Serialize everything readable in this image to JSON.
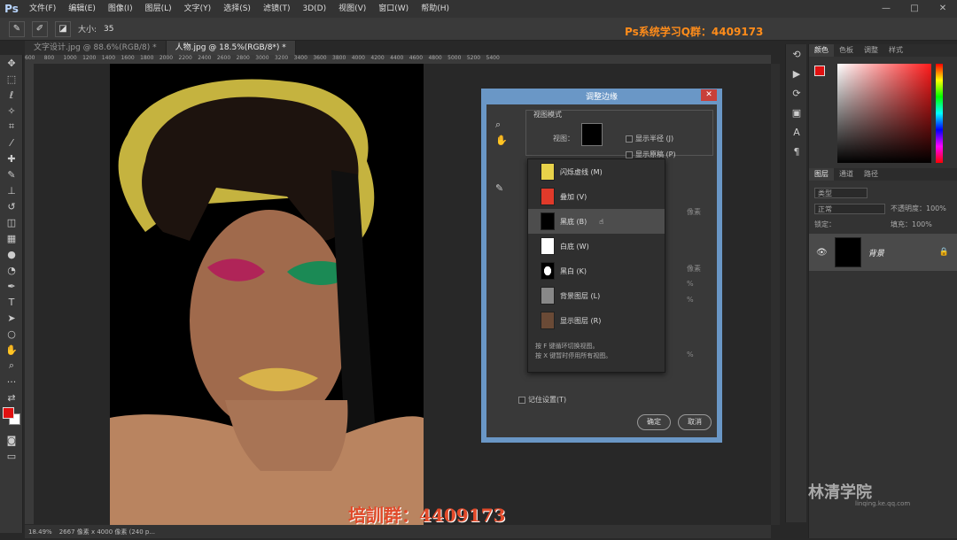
{
  "app": {
    "logo": "Ps"
  },
  "menu": [
    "文件(F)",
    "编辑(E)",
    "图像(I)",
    "图层(L)",
    "文字(Y)",
    "选择(S)",
    "滤镜(T)",
    "3D(D)",
    "视图(V)",
    "窗口(W)",
    "帮助(H)"
  ],
  "options": {
    "size_label": "大小:",
    "size_value": "35"
  },
  "banner": "Ps系统学习Q群：4409173",
  "tabs": [
    {
      "label": "文字设计.jpg @ 88.6%(RGB/8) *"
    },
    {
      "label": "人物.jpg @ 18.5%(RGB/8*) *"
    }
  ],
  "ruler": [
    "600",
    "800",
    "1000",
    "1200",
    "1400",
    "1600",
    "1800",
    "2000",
    "2200",
    "2400",
    "2600",
    "2800",
    "3000",
    "3200",
    "3400",
    "3600",
    "3800",
    "4000",
    "4200",
    "4400",
    "4600",
    "4800",
    "5000",
    "5200",
    "5400"
  ],
  "status": {
    "zoom": "18.49%",
    "doc": "2667 像素 x 4000 像素 (240 p..."
  },
  "watermark": "培訓群：4409173",
  "panel": {
    "color_tabs": [
      "颜色",
      "色板",
      "调整",
      "样式"
    ],
    "layer_tabs": [
      "图层",
      "通道",
      "路径"
    ],
    "kind": "类型",
    "blend": "正常",
    "opacity": "不透明度：100%",
    "lock": "锁定：",
    "fill": "填充：100%",
    "layer_name": "背景"
  },
  "logo": {
    "name": "林清学院",
    "url": "linqing.ke.qq.com"
  },
  "dialog": {
    "title": "调整边缘",
    "view_mode_title": "视图模式",
    "view_label": "视图：",
    "show_radius": "显示半径 (J)",
    "show_original": "显示原稿 (P)",
    "remember": "记住设置(T)",
    "ok": "确定",
    "cancel": "取消",
    "faded": {
      "pixels1": "像素",
      "pixels2": "像素",
      "pct1": "%",
      "pct2": "%",
      "pct3": "%"
    },
    "menu_items": [
      {
        "label": "闪烁虚线 (M)"
      },
      {
        "label": "叠加 (V)"
      },
      {
        "label": "黑底 (B)"
      },
      {
        "label": "白底 (W)"
      },
      {
        "label": "黑白 (K)"
      },
      {
        "label": "背景图层 (L)"
      },
      {
        "label": "显示图层 (R)"
      }
    ],
    "hint1": "按 F 键循环切换视图。",
    "hint2": "按 X 键暂时停用所有视图。"
  },
  "colors": {
    "fg": "#e01010",
    "bg": "#ffffff",
    "accent": "#6a97c6"
  }
}
